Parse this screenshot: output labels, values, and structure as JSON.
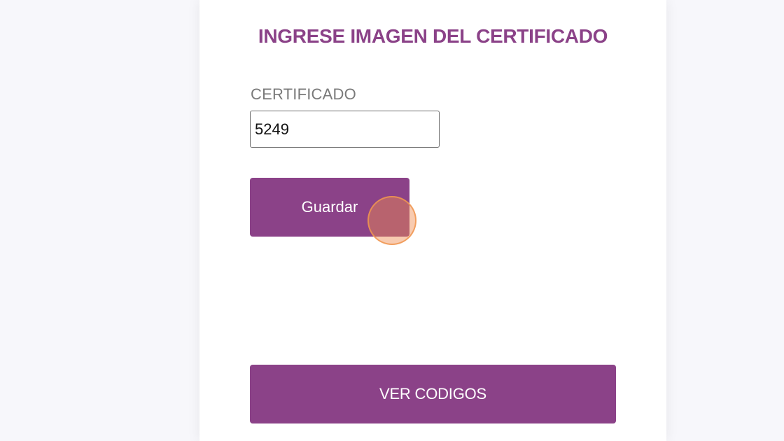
{
  "form": {
    "title": "INGRESE IMAGEN DEL CERTIFICADO",
    "certificate_label": "CERTIFICADO",
    "certificate_value": "5249",
    "save_label": "Guardar",
    "view_codes_label": "VER CODIGOS"
  },
  "colors": {
    "accent": "#8b4288",
    "background": "#f7f7fb",
    "card": "#ffffff",
    "label": "#7a7a7a",
    "click_indicator": "#f08c50"
  }
}
